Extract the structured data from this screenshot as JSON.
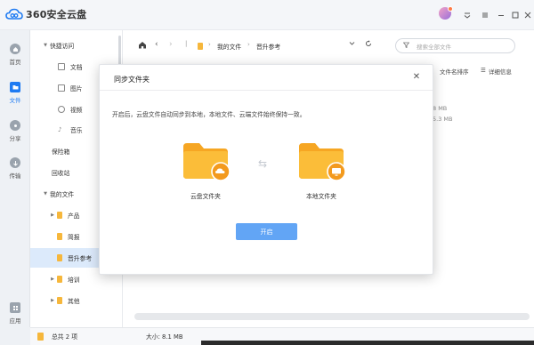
{
  "app": {
    "logo_text": "360安全云盘"
  },
  "left_nav": {
    "items": [
      {
        "label": "首页",
        "icon": "home-icon"
      },
      {
        "label": "文件",
        "icon": "folder-icon"
      },
      {
        "label": "分享",
        "icon": "share-icon"
      },
      {
        "label": "传输",
        "icon": "transfer-icon"
      },
      {
        "label": "应用",
        "icon": "apps-icon"
      }
    ]
  },
  "sidebar": {
    "quick_access": "快捷访问",
    "quick_items": [
      "文档",
      "图片",
      "视频",
      "音乐"
    ],
    "vault": "保险箱",
    "recycle": "回收站",
    "my_files": "我的文件",
    "folders": [
      "产品",
      "简报",
      "晋升参考",
      "培训",
      "其他"
    ]
  },
  "navbar": {
    "breadcrumb": [
      "我的文件",
      "晋升参考"
    ],
    "search_placeholder": "搜索全部文件"
  },
  "toolbar2": {
    "sort_label": "文件名排序",
    "detail_label": "详细信息"
  },
  "background_sizes": [
    "8 MB",
    "5.3 MB"
  ],
  "status": {
    "total": "总共 2 项",
    "size": "大小: 8.1 MB"
  },
  "dialog": {
    "title": "同步文件夹",
    "message": "开启后，云盘文件自动同步到本地，本地文件、云端文件始终保持一致。",
    "cloud_label": "云盘文件夹",
    "local_label": "本地文件夹",
    "button_label": "开启"
  },
  "colors": {
    "accent": "#1f7bf2",
    "folder": "#f6b73c",
    "button": "#62a5f5"
  }
}
